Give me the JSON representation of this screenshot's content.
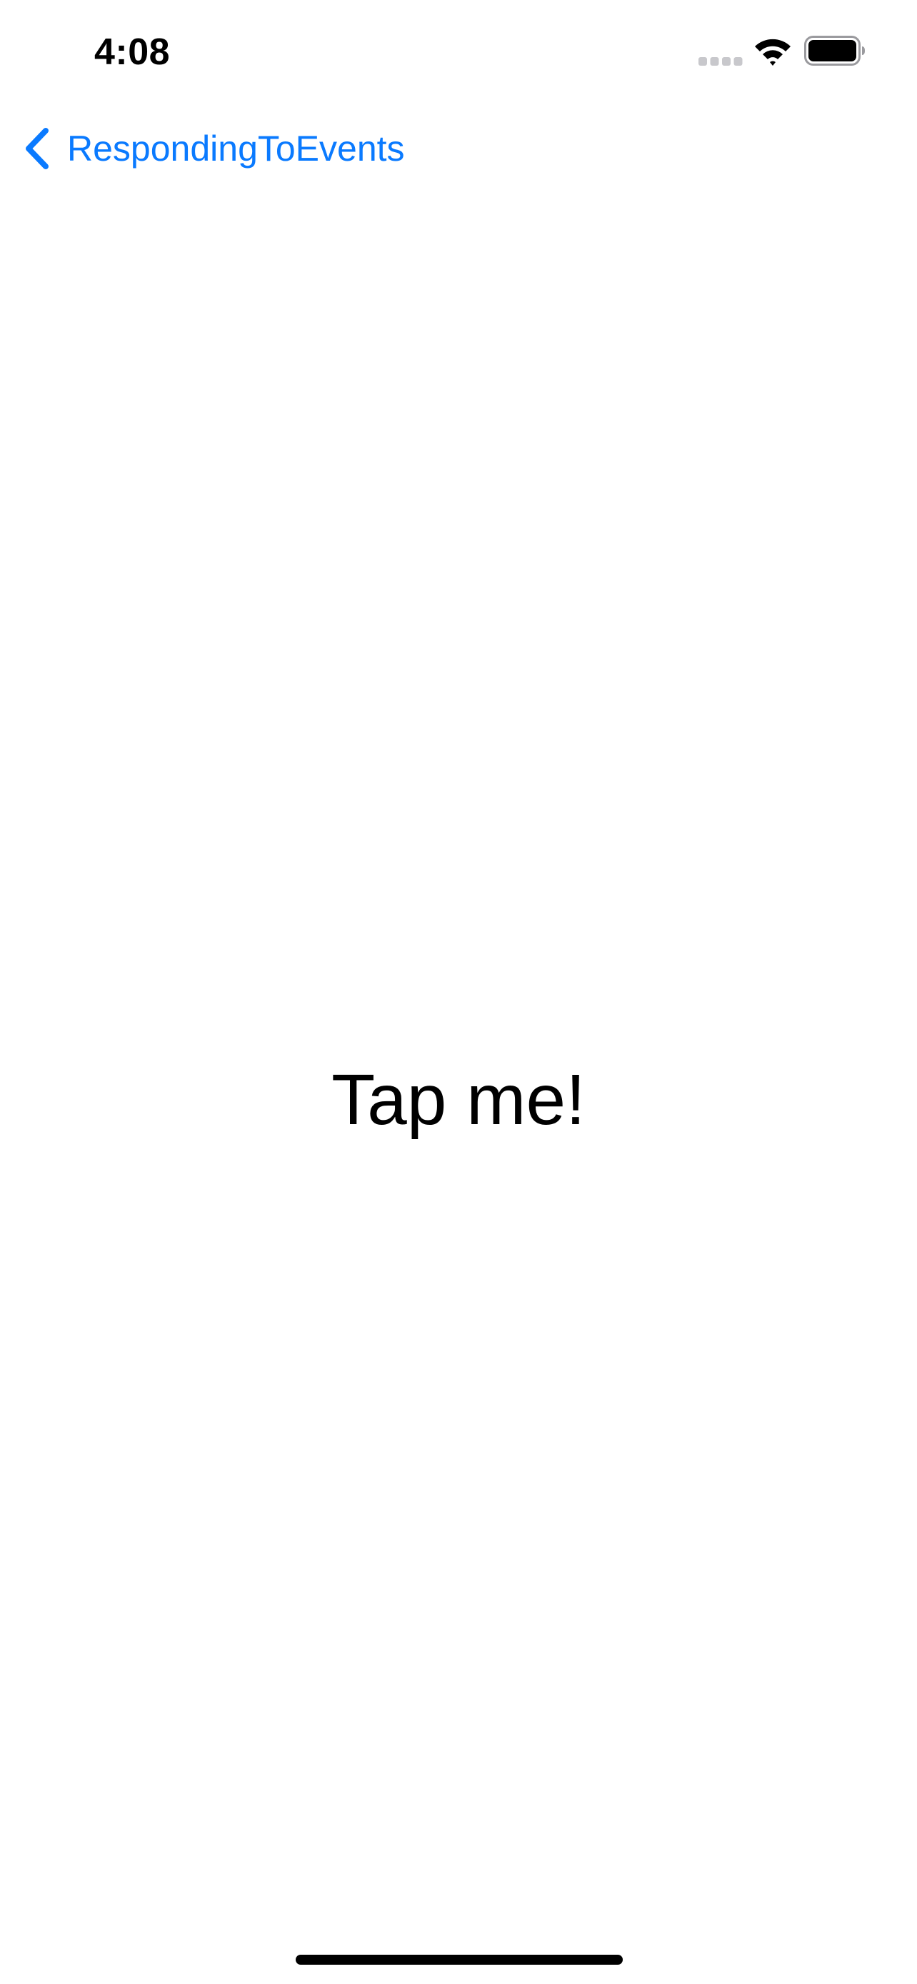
{
  "status_bar": {
    "time": "4:08",
    "icons": [
      "cellular-signal-icon",
      "wifi-icon",
      "battery-icon"
    ]
  },
  "nav_bar": {
    "back_label": "RespondingToEvents",
    "back_icon": "chevron-left-icon"
  },
  "main": {
    "tap_label": "Tap me!"
  },
  "colors": {
    "accent": "#0a7aff",
    "text": "#000000",
    "background": "#ffffff",
    "signal_inactive": "#c8c8cc"
  }
}
